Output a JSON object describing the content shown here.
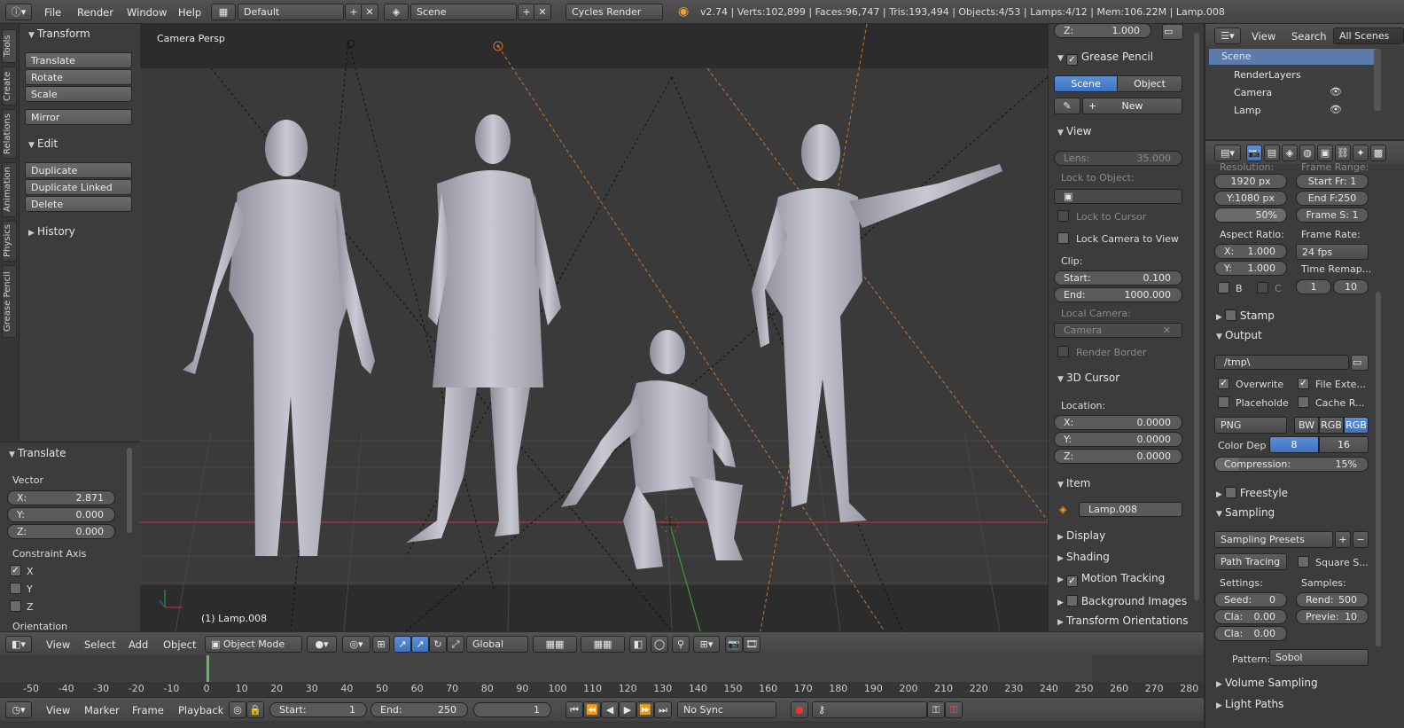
{
  "topbar": {
    "info_icon": "info-icon",
    "menus": [
      "File",
      "Render",
      "Window",
      "Help"
    ],
    "screen_layout": "Default",
    "scene": "Scene",
    "engine": "Cycles Render",
    "stats": "v2.74 | Verts:102,899 | Faces:96,747 | Tris:193,494 | Objects:4/53 | Lamps:4/12 | Mem:106.22M | Lamp.008"
  },
  "tabs": [
    "Tools",
    "Create",
    "Relations",
    "Animation",
    "Physics",
    "Grease Pencil"
  ],
  "toolshelf": {
    "transform_title": "Transform",
    "transform_buttons": [
      "Translate",
      "Rotate",
      "Scale",
      "Mirror"
    ],
    "edit_title": "Edit",
    "edit_buttons": [
      "Duplicate",
      "Duplicate Linked",
      "Delete"
    ],
    "history_title": "History"
  },
  "redo": {
    "title": "Translate",
    "vector_label": "Vector",
    "x_label": "X:",
    "x": "2.871",
    "y_label": "Y:",
    "y": "0.000",
    "z_label": "Z:",
    "z": "0.000",
    "constraint_label": "Constraint Axis",
    "axes": [
      "X",
      "Y",
      "Z"
    ],
    "axes_checked": [
      true,
      false,
      false
    ],
    "orientation_label": "Orientation"
  },
  "viewport": {
    "label": "Camera Persp",
    "object_label": "(1) Lamp.008"
  },
  "npanel": {
    "z_label": "Z:",
    "z_value": "1.000",
    "grease_title": "Grease Pencil",
    "scene_tab": "Scene",
    "object_tab": "Object",
    "new_label": "New",
    "view_title": "View",
    "lens_label": "Lens:",
    "lens_value": "35.000",
    "lock_object_label": "Lock to Object:",
    "lock_cursor": "Lock to Cursor",
    "lock_camera": "Lock Camera to View",
    "clip_label": "Clip:",
    "clip_start_label": "Start:",
    "clip_start": "0.100",
    "clip_end_label": "End:",
    "clip_end": "1000.000",
    "local_camera_label": "Local Camera:",
    "local_camera": "Camera",
    "render_border": "Render Border",
    "cursor_title": "3D Cursor",
    "location_label": "Location:",
    "cx": "0.0000",
    "cy": "0.0000",
    "cz": "0.0000",
    "item_title": "Item",
    "item_name": "Lamp.008",
    "collapsed": [
      "Display",
      "Shading",
      "Motion Tracking",
      "Background Images",
      "Transform Orientations"
    ]
  },
  "vheader": {
    "menus": [
      "View",
      "Select",
      "Add",
      "Object"
    ],
    "mode": "Object Mode",
    "orientation": "Global"
  },
  "timeline": {
    "ticks": [
      "-50",
      "-40",
      "-30",
      "-20",
      "-10",
      "0",
      "10",
      "20",
      "30",
      "40",
      "50",
      "60",
      "70",
      "80",
      "90",
      "100",
      "110",
      "120",
      "130",
      "140",
      "150",
      "160",
      "170",
      "180",
      "190",
      "200",
      "210",
      "220",
      "230",
      "240",
      "250",
      "260",
      "270",
      "280"
    ],
    "current_frame": 1
  },
  "tlheader": {
    "menus": [
      "View",
      "Marker",
      "Frame",
      "Playback"
    ],
    "start_label": "Start:",
    "start": "1",
    "end_label": "End:",
    "end": "250",
    "current": "1",
    "sync": "No Sync"
  },
  "outliner": {
    "menus": [
      "View",
      "Search"
    ],
    "filter": "All Scenes",
    "items": [
      "Scene",
      "RenderLayers",
      "Camera",
      "Lamp"
    ]
  },
  "props": {
    "resolution_label": "Resolution:",
    "frame_range_label": "Frame Range:",
    "res_x": "1920 px",
    "res_y": "Y:1080 px",
    "res_pct": "50%",
    "start_fr": "Start Fr: 1",
    "end_fr": "End F:250",
    "frame_step": "Frame S: 1",
    "aspect_label": "Aspect Ratio:",
    "frame_rate_label": "Frame Rate:",
    "asp_x_label": "X:",
    "asp_x": "1.000",
    "asp_y_label": "Y:",
    "asp_y": "1.000",
    "fps": "24 fps",
    "time_remap_label": "Time Remap...",
    "remap_old": "1",
    "remap_new": "10",
    "b_label": "B",
    "c_label": "C",
    "stamp": "Stamp",
    "output": "Output",
    "path": "/tmp\\",
    "overwrite": "Overwrite",
    "file_ext": "File Exte...",
    "placeholder": "Placeholde",
    "cache": "Cache R...",
    "format": "PNG",
    "bw": "BW",
    "rgb": "RGB",
    "rgba": "RGB",
    "color_depth_label": "Color Dep",
    "depth8": "8",
    "depth16": "16",
    "compression": "Compression:",
    "compression_value": "15%",
    "freestyle": "Freestyle",
    "sampling": "Sampling",
    "sampling_presets": "Sampling Presets",
    "path_tracing": "Path Tracing",
    "square": "Square S...",
    "settings_label": "Settings:",
    "samples_label": "Samples:",
    "seed_label": "Seed:",
    "seed": "0",
    "cla1_label": "Cla:",
    "cla1": "0.00",
    "cla2_label": "Cla:",
    "cla2": "0.00",
    "render_label": "Rend:",
    "render": "500",
    "preview_label": "Previe:",
    "preview": "10",
    "pattern_label": "Pattern:",
    "pattern": "Sobol",
    "volume": "Volume Sampling",
    "light_paths": "Light Paths"
  },
  "colors": {
    "accent": "#5680c2",
    "grid_red": "#a83a3a",
    "cam_orange": "#d8813a"
  }
}
